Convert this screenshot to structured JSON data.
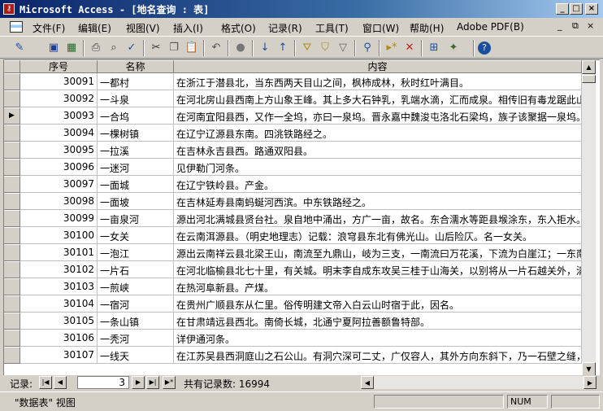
{
  "window": {
    "title": "Microsoft Access - [地名查询 : 表]",
    "app_icon": "access-key-icon",
    "controls": [
      "_",
      "□",
      "×"
    ]
  },
  "menubar": {
    "items": [
      "文件(F)",
      "编辑(E)",
      "视图(V)",
      "插入(I)",
      "格式(O)",
      "记录(R)",
      "工具(T)",
      "窗口(W)",
      "帮助(H)",
      "Adobe PDF(B)"
    ],
    "doc_controls": [
      "_",
      "⧉",
      "×"
    ]
  },
  "toolbar": {
    "icons": [
      "design-view-icon",
      "save-icon",
      "print-preview-icon",
      "print-icon",
      "preview-icon",
      "spelling-icon",
      "cut-icon",
      "copy-icon",
      "paste-icon",
      "undo-icon",
      "insert-hyperlink-icon",
      "sort-ascending-icon",
      "sort-descending-icon",
      "filter-by-selection-icon",
      "filter-by-form-icon",
      "apply-filter-icon",
      "find-icon",
      "new-record-icon",
      "delete-record-icon",
      "database-window-icon",
      "new-object-icon",
      "help-icon"
    ]
  },
  "grid": {
    "columns": [
      "序号",
      "名称",
      "内容"
    ],
    "current_row_index": 2,
    "rows": [
      {
        "id": "30091",
        "name": "一都村",
        "content": "在浙江于潜县北，当东西两天目山之间，枫柿成林，秋时红叶满目。"
      },
      {
        "id": "30092",
        "name": "一斗泉",
        "content": "在河北房山县西南上方山象王峰。其上多大石钟乳，乳端水滴，汇而成泉。相传旧有毒龙踞此山"
      },
      {
        "id": "30093",
        "name": "一合坞",
        "content": "在河南宜阳县西，又作一全坞，亦曰一泉坞。晋永嘉中魏浚屯洛北石梁坞，族子该聚据一泉坞。"
      },
      {
        "id": "30094",
        "name": "一棵树镇",
        "content": "在辽宁辽源县东南。四洮铁路经之。"
      },
      {
        "id": "30095",
        "name": "一拉溪",
        "content": "在吉林永吉县西。路通双阳县。"
      },
      {
        "id": "30096",
        "name": "一迷河",
        "content": "见伊勒门河条。"
      },
      {
        "id": "30097",
        "name": "一面城",
        "content": "在辽宁铁岭县。产金。"
      },
      {
        "id": "30098",
        "name": "一面坡",
        "content": "在吉林延寿县南蚂蜒河西滨。中东铁路经之。"
      },
      {
        "id": "30099",
        "name": "一亩泉河",
        "content": "源出河北满城县贤台社。泉自地中涌出，方广一亩，故名。东合濡水等距县堠涂东，东入拒水。"
      },
      {
        "id": "30100",
        "name": "一女关",
        "content": "在云南洱源县。（明史地理志）记载：浪穹县东北有佛光山。山后险仄。名一女关。"
      },
      {
        "id": "30101",
        "name": "一泡江",
        "content": "源出云南祥云县北梁王山，南流至九鼎山，岐为三支，一南流曰万花溪，下流为白崖江；一东南"
      },
      {
        "id": "30102",
        "name": "一片石",
        "content": "在河北临榆县北七十里，有关城。明末李自成东攻吴三桂于山海关，以别将从一片石越关外，清"
      },
      {
        "id": "30103",
        "name": "一煎峡",
        "content": "在热河阜新县。产煤。"
      },
      {
        "id": "30104",
        "name": "一宿河",
        "content": "在贵州广顺县东从仁里。俗传明建文帝入白云山时宿于此，因名。"
      },
      {
        "id": "30105",
        "name": "一条山镇",
        "content": "在甘肃靖远县西北。南倚长城，北通宁夏阿拉善额鲁特部。"
      },
      {
        "id": "30106",
        "name": "一秃河",
        "content": "详伊通河条。"
      },
      {
        "id": "30107",
        "name": "一线天",
        "content": "在江苏吴县西洞庭山之石公山。有洞穴深可二丈，广仅容人，其外方向东斜下，乃一石壁之缝，"
      }
    ]
  },
  "navigation": {
    "label": "记录:",
    "current_record": "3",
    "total_text": "共有记录数: 16994"
  },
  "statusbar": {
    "view_text": "\"数据表\" 视图",
    "num_indicator": "NUM"
  }
}
